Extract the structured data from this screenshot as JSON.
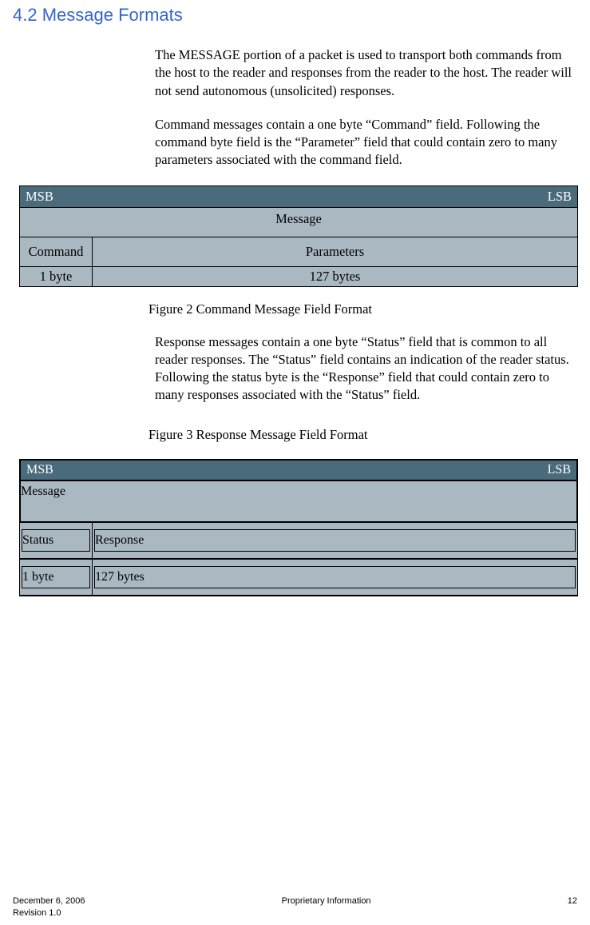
{
  "heading": "4.2  Message Formats",
  "para1": "The MESSAGE portion of a packet is used to transport both commands from the host to the reader and responses from the reader to the host.  The reader will not send autonomous (unsolicited) responses.",
  "para2": "Command messages contain a one byte “Command” field.  Following the command byte field is the “Parameter” field that could contain zero to many parameters associated with the command field.",
  "para3": "Response messages contain a one byte “Status” field that is common to all reader responses.  The “Status” field contains an indication of the reader status.  Following the status byte is the “Response” field that could contain zero to many responses associated with the “Status” field.",
  "figure2_caption": "Figure 2 Command Message Field Format",
  "figure3_caption": "Figure 3 Response Message Field Format",
  "table1": {
    "msb": "MSB",
    "lsb": "LSB",
    "message": "Message",
    "left_field": "Command",
    "right_field": "Parameters",
    "left_size": "1 byte",
    "right_size": "127 bytes"
  },
  "table2": {
    "msb": "MSB",
    "lsb": "LSB",
    "message": "Message",
    "left_field": "Status",
    "right_field": "Response",
    "left_size": "1 byte",
    "right_size": "127 bytes"
  },
  "footer": {
    "date": "December 6, 2006",
    "center": "Proprietary Information",
    "page": "12",
    "revision": "Revision 1.0"
  }
}
